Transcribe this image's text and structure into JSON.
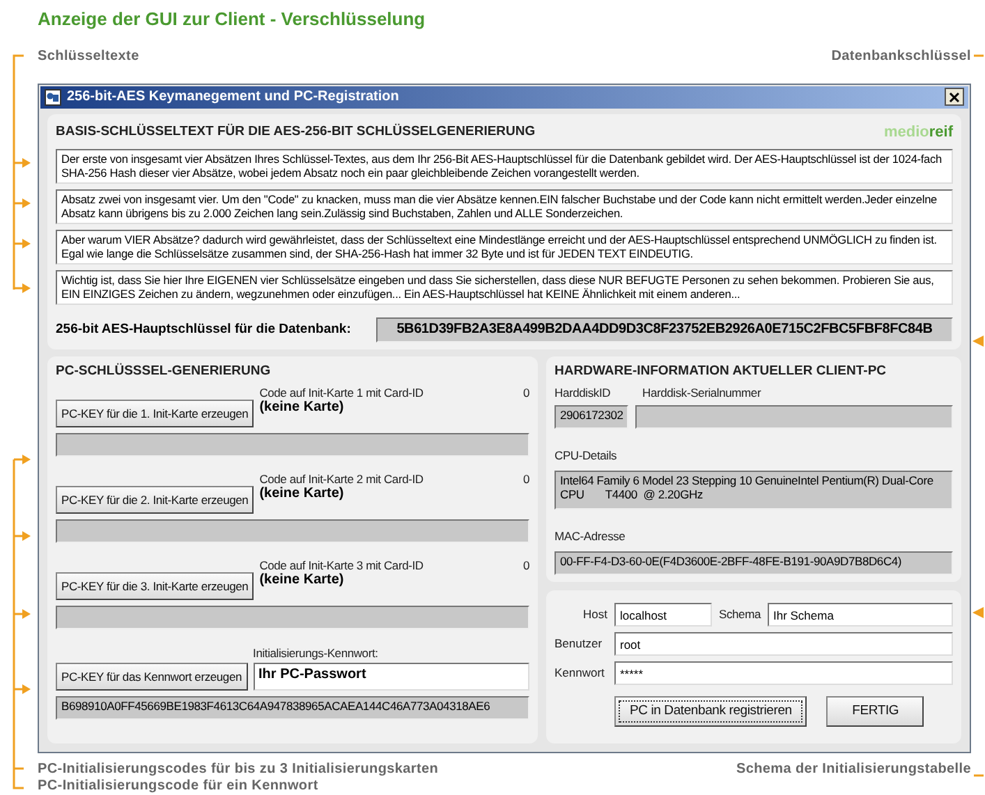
{
  "page_title": "Anzeige der GUI zur Client - Verschlüsselung",
  "annotations": {
    "top_left": "Schlüsseltexte",
    "top_right": "Datenbankschlüssel",
    "bottom_left": [
      "PC-Initialisierungscodes für bis zu 3 Initialisierungskarten",
      "PC-Initialisierungscode für ein Kennwort"
    ],
    "bottom_right": "Schema der Initialisierungstabelle"
  },
  "window": {
    "title": "256-bit-AES Keymanegement und PC-Registration"
  },
  "key_text": {
    "heading": "BASIS-SCHLÜSSELTEXT FÜR DIE AES-256-BIT SCHLÜSSELGENERIERUNG",
    "logo": [
      "medio",
      "reif"
    ],
    "paragraphs": [
      "Der erste von insgesamt vier Absätzen Ihres Schlüssel-Textes, aus dem Ihr 256-Bit AES-Hauptschlüssel für die Datenbank gebildet wird. Der AES-Hauptschlüssel ist der 1024-fach SHA-256 Hash dieser vier Absätze, wobei jedem Absatz noch ein paar gleichbleibende Zeichen vorangestellt werden.",
      "Absatz zwei von insgesamt vier. Um den \"Code\" zu knacken, muss man die vier Absätze kennen.EIN falscher Buchstabe und der Code kann nicht ermittelt werden.Jeder einzelne Absatz kann übrigens bis zu 2.000 Zeichen lang sein.Zulässig sind Buchstaben, Zahlen und ALLE Sonderzeichen.",
      "Aber warum VIER Absätze? dadurch wird gewährleistet, dass der Schlüsseltext eine Mindestlänge erreicht und der AES-Hauptschlüssel entsprechend UNMÖGLICH zu finden ist. Egal wie lange die Schlüsselsätze zusammen sind, der SHA-256-Hash hat immer 32 Byte und ist für JEDEN TEXT EINDEUTIG.",
      "Wichtig ist, dass Sie hier Ihre EIGENEN vier Schlüsselsätze eingeben und dass Sie sicherstellen, dass diese NUR BEFUGTE Personen zu sehen bekommen. Probieren Sie aus, EIN EINZIGES Zeichen zu ändern, wegzunehmen oder einzufügen... Ein AES-Hauptschlüssel hat KEINE Ähnlichkeit mit einem anderen..."
    ],
    "master_key_label": "256-bit AES-Hauptschlüssel für die Datenbank:",
    "master_key": "5B61D39FB2A3E8A499B2DAA4DD9D3C8F23752EB2926A0E715C2FBC5FBF8FC84B"
  },
  "pc_key": {
    "heading": "PC-SCHLÜSSSEL-GENERIERUNG",
    "cards": [
      {
        "button": "PC-KEY für die 1. Init-Karte erzeugen",
        "label": "Code auf Init-Karte 1 mit Card-ID",
        "card_id": "0",
        "status": "(keine Karte)"
      },
      {
        "button": "PC-KEY für die 2. Init-Karte erzeugen",
        "label": "Code auf Init-Karte 2 mit Card-ID",
        "card_id": "0",
        "status": "(keine Karte)"
      },
      {
        "button": "PC-KEY für die 3. Init-Karte erzeugen",
        "label": "Code auf Init-Karte 3 mit Card-ID",
        "card_id": "0",
        "status": "(keine Karte)"
      }
    ],
    "password": {
      "button": "PC-KEY für das Kennwort erzeugen",
      "label": "Initialisierungs-Kennwort:",
      "value": "Ihr PC-Passwort",
      "code": "B698910A0FF45669BE1983F4613C64A947838965ACAEA144C46A773A04318AE6"
    }
  },
  "hardware": {
    "heading": "HARDWARE-INFORMATION AKTUELLER CLIENT-PC",
    "disk_id_label": "HarddiskID",
    "disk_id": "2906172302",
    "serial_label": "Harddisk-Serialnummer",
    "cpu_label": "CPU-Details",
    "cpu": "Intel64 Family 6 Model 23 Stepping 10 GenuineIntel Pentium(R) Dual-Core CPU       T4400  @ 2.20GHz",
    "mac_label": "MAC-Adresse",
    "mac": "00-FF-F4-D3-60-0E(F4D3600E-2BFF-48FE-B191-90A9D7B8D6C4)"
  },
  "database": {
    "host_label": "Host",
    "host": "localhost",
    "schema_label": "Schema",
    "schema": "Ihr Schema",
    "user_label": "Benutzer",
    "user": "root",
    "password_label": "Kennwort",
    "password": "*****",
    "buttons": [
      {
        "label": "PC in Datenbank registrieren",
        "focused": true
      },
      {
        "label": "FERTIG",
        "focused": false
      }
    ]
  }
}
